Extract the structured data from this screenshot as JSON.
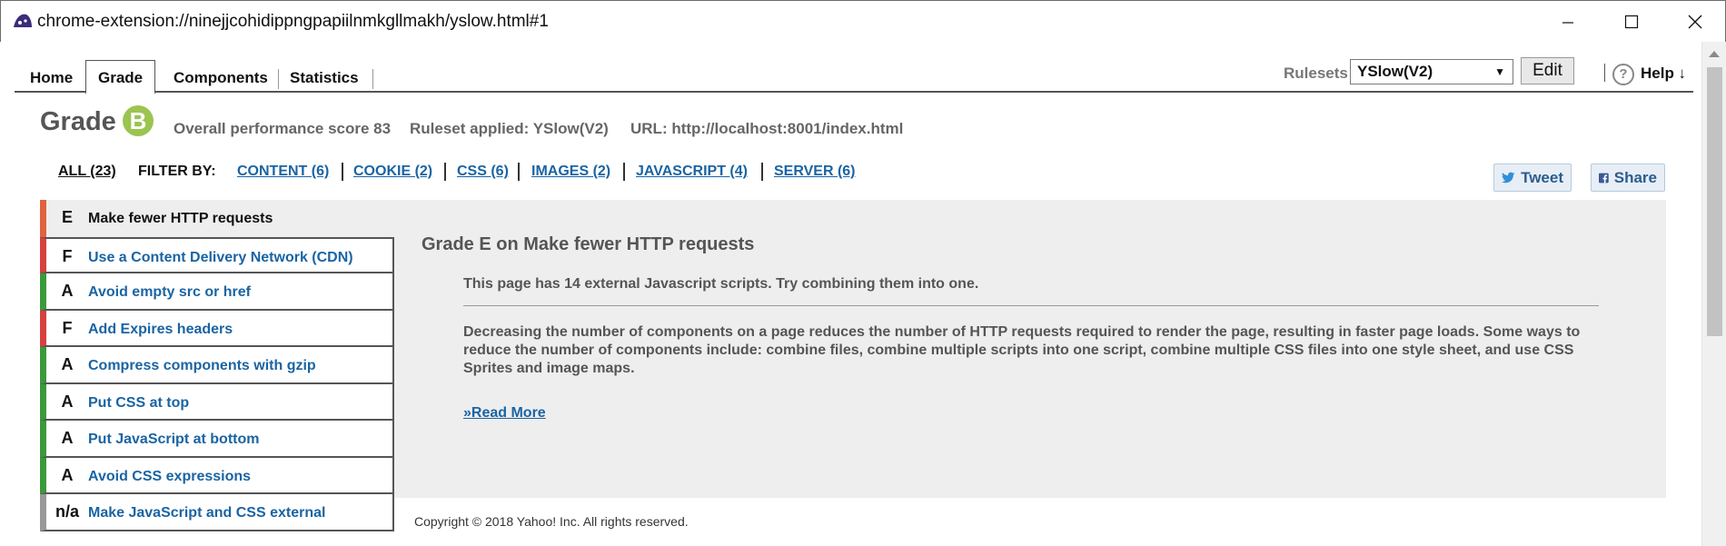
{
  "window": {
    "title": "chrome-extension://ninejjcohidippngpapiilnmkgllmakh/yslow.html#1"
  },
  "tabs": [
    {
      "label": "Home"
    },
    {
      "label": "Grade"
    },
    {
      "label": "Components"
    },
    {
      "label": "Statistics"
    }
  ],
  "toolbar": {
    "rulesets_label": "Rulesets",
    "ruleset_value": "YSlow(V2)",
    "edit_label": "Edit",
    "help_icon": "?",
    "help_label": "Help ↓"
  },
  "grade": {
    "label": "Grade",
    "letter": "B",
    "overall": "Overall performance score 83",
    "ruleset": "Ruleset applied: YSlow(V2)",
    "url": "URL: http://localhost:8001/index.html"
  },
  "filter": {
    "all": "ALL (23)",
    "by": "FILTER BY:",
    "items": [
      {
        "label": "CONTENT (6)"
      },
      {
        "label": "COOKIE (2)"
      },
      {
        "label": "CSS (6)"
      },
      {
        "label": "IMAGES (2)"
      },
      {
        "label": "JAVASCRIPT (4)"
      },
      {
        "label": "SERVER (6)"
      }
    ]
  },
  "social": {
    "tweet": "Tweet",
    "share": "Share"
  },
  "rules": [
    {
      "grade": "E",
      "title": "Make fewer HTTP requests"
    },
    {
      "grade": "F",
      "title": "Use a Content Delivery Network (CDN)"
    },
    {
      "grade": "A",
      "title": "Avoid empty src or href"
    },
    {
      "grade": "F",
      "title": "Add Expires headers"
    },
    {
      "grade": "A",
      "title": "Compress components with gzip"
    },
    {
      "grade": "A",
      "title": "Put CSS at top"
    },
    {
      "grade": "A",
      "title": "Put JavaScript at bottom"
    },
    {
      "grade": "A",
      "title": "Avoid CSS expressions"
    },
    {
      "grade": "n/a",
      "title": "Make JavaScript and CSS external"
    }
  ],
  "detail": {
    "title": "Grade E on Make fewer HTTP requests",
    "message": "This page has 14 external Javascript scripts. Try combining them into one.",
    "description": "Decreasing the number of components on a page reduces the number of HTTP requests required to render the page, resulting in faster page loads. Some ways to reduce the number of components include: combine files, combine multiple scripts into one script, combine multiple CSS files into one style sheet, and use CSS Sprites and image maps.",
    "read_more": "»Read More"
  },
  "footer": {
    "copyright": "Copyright © 2018 Yahoo! Inc. All rights reserved."
  },
  "colors": {
    "link": "#1a64a3",
    "grade_b": "#9cc450",
    "grade_a": "#3a9a3a",
    "grade_e": "#e0633d",
    "grade_f": "#d64040",
    "grade_na": "#999999",
    "panel_bg": "#eeeeee"
  }
}
